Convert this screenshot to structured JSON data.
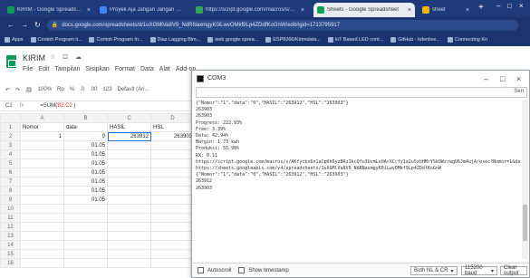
{
  "browser": {
    "tabs": [
      {
        "title": "KIRIM - Google Spreadsheet",
        "color": "#0f9d58",
        "active": false
      },
      {
        "title": "Proyek Aja Jangan Jangan Lah",
        "color": "#4285f4",
        "active": false
      },
      {
        "title": "https://script.google.com/macros/s/AKf",
        "color": "#34a853",
        "active": false
      },
      {
        "title": "Sheets - Google Spreadsheet",
        "color": "#0f9d58",
        "active": true
      },
      {
        "title": "sheet",
        "color": "#f4b400",
        "active": false
      }
    ],
    "new_tab_symbol": "+",
    "window_controls": [
      "–",
      "□",
      "×"
    ],
    "url": "docs.google.com/spreadsheets/d/1uXGMlVa8V9_NdRNaxmgyK0iLwvOMkf9Lp4ZDdfKoGnW/edit#gid=1713795917",
    "bookmarks": [
      "Apps",
      "Contoh Program li...",
      "Contoh Program In...",
      "Diaz Lagging Blm...",
      "web google sprea...",
      "ESP8266/Kirimdata...",
      "loT Based LED cont...",
      "GitHub - kdenlive...",
      "Connecting Kn"
    ]
  },
  "sheets": {
    "doc_title": "KIRIM",
    "title_icons": "☆ ⊡ ☁",
    "menu": [
      "File",
      "Edit",
      "Tampilan",
      "Sisipkan",
      "Format",
      "Data",
      "Alat",
      "Add-on"
    ],
    "tools": [
      "↶",
      "↷",
      "🖨",
      "100%",
      "Rp",
      "%",
      ".0",
      ".00",
      "123",
      "Default (Ari..."
    ],
    "name_box": "C2",
    "fx_label": "fx",
    "formula_prefix": "=SUM(",
    "formula_ref": "B2:C2 ",
    "formula_suffix": ")",
    "columns": [
      "A",
      "B",
      "C",
      "D"
    ],
    "rows": [
      {
        "n": "1",
        "cells": [
          "Nomor",
          "data",
          "HASIL",
          "HSL"
        ]
      },
      {
        "n": "2",
        "cells": [
          "1",
          "0",
          "263912",
          "263903"
        ]
      },
      {
        "n": "3",
        "cells": [
          "",
          "01.05",
          "",
          ""
        ]
      },
      {
        "n": "4",
        "cells": [
          "",
          "01.05",
          "",
          ""
        ]
      },
      {
        "n": "5",
        "cells": [
          "",
          "01.05",
          "",
          ""
        ]
      },
      {
        "n": "6",
        "cells": [
          "",
          "01.05",
          "",
          ""
        ]
      },
      {
        "n": "7",
        "cells": [
          "",
          "01.05",
          "",
          ""
        ]
      },
      {
        "n": "8",
        "cells": [
          "",
          "01.05",
          "",
          ""
        ]
      },
      {
        "n": "9",
        "cells": [
          "",
          "01.05",
          "",
          ""
        ]
      },
      {
        "n": "10",
        "cells": [
          "",
          "",
          "",
          ""
        ]
      },
      {
        "n": "11",
        "cells": [
          "",
          "",
          "",
          ""
        ]
      },
      {
        "n": "12",
        "cells": [
          "",
          "",
          "",
          ""
        ]
      },
      {
        "n": "13",
        "cells": [
          "",
          "",
          "",
          ""
        ]
      },
      {
        "n": "14",
        "cells": [
          "",
          "",
          "",
          ""
        ]
      },
      {
        "n": "15",
        "cells": [
          "",
          "",
          "",
          ""
        ]
      },
      {
        "n": "16",
        "cells": [
          "",
          "",
          "",
          ""
        ]
      }
    ]
  },
  "cmd": {
    "title": "COM3",
    "window_controls": [
      "–",
      "□",
      "×"
    ],
    "send_label": "Sen",
    "output": [
      "{\"Nomor\":\"1\",\"data\":\"0\",\"HASIL\":\"263912\",\"HSL\":\"263903\"}",
      "263903",
      "263903",
      "Progress: 222.93%",
      "Free: 3.39%",
      "Data: 42.94%",
      "Margin: 1.73 kwh",
      "Produksi: 55.98%",
      "RX: 0.11",
      "https://script.google.com/macros/s/AKfycbx6n1aCpKh6yzBRzIkcQfu3UcmLv0ArXCrfy1a2u5zbHMrYSk0WzrwgU6Jm4ujA/exec?Nomor=1&data=0",
      "https://sheets.googleapis.com/v4/spreadsheets/1uXGMlVa8V9_NdRNaxmgyK0iLwvOMkf9Lp4ZDdfKoGnW",
      "{\"Nomor\":\"1\",\"data\":\"0\",\"HASIL\":\"263912\",\"HSL\":\"263903\"}",
      "263912",
      "263903"
    ],
    "autoscroll_label": "Autoscroll",
    "timestamp_label": "Show timestamp",
    "line_ending": "Both NL & CR",
    "baud": "115200 baud",
    "clear_label": "Clear output"
  }
}
